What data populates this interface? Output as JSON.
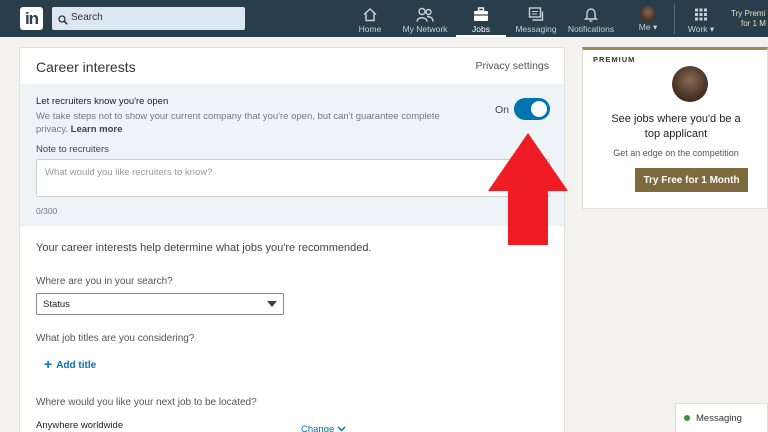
{
  "nav": {
    "logo": "in",
    "search_placeholder": "Search",
    "items": [
      {
        "label": "Home",
        "icon": "home-icon"
      },
      {
        "label": "My Network",
        "icon": "network-icon"
      },
      {
        "label": "Jobs",
        "icon": "jobs-icon"
      },
      {
        "label": "Messaging",
        "icon": "messaging-icon"
      },
      {
        "label": "Notifications",
        "icon": "bell-icon"
      },
      {
        "label": "Me ▾",
        "icon": "avatar"
      },
      {
        "label": "Work ▾",
        "icon": "grid-icon"
      }
    ],
    "try_premium_line1": "Try Premi",
    "try_premium_line2": "for 1 M"
  },
  "card": {
    "title": "Career interests",
    "privacy": "Privacy settings",
    "recruiter_title": "Let recruiters know you're open",
    "recruiter_desc": "We take steps not to show your current company that you're open, but can't guarantee complete privacy.",
    "learn_more": "Learn more",
    "toggle_label": "On",
    "note_label": "Note to recruiters",
    "note_placeholder": "What would you like recruiters to know?",
    "note_count": "0/300",
    "intro": "Your career interests help determine what jobs you're recommended.",
    "q_search": "Where are you in your search?",
    "status_value": "Status",
    "q_titles": "What job titles are you considering?",
    "add_title": "Add title",
    "q_location": "Where would you like your next job to be located?",
    "location_value": "Anywhere worldwide",
    "change": "Change"
  },
  "premium": {
    "label": "PREMIUM",
    "headline_1": "See jobs where you'd be a",
    "headline_2": "top applicant",
    "sub": "Get an edge on the competition",
    "button": "Try Free for 1 Month"
  },
  "messaging": {
    "label": "Messaging"
  },
  "colors": {
    "nav_bg": "#283e4a",
    "toggle_on": "#0073b1",
    "premium_btn": "#7f6a3d",
    "arrow": "#ee1c25"
  }
}
